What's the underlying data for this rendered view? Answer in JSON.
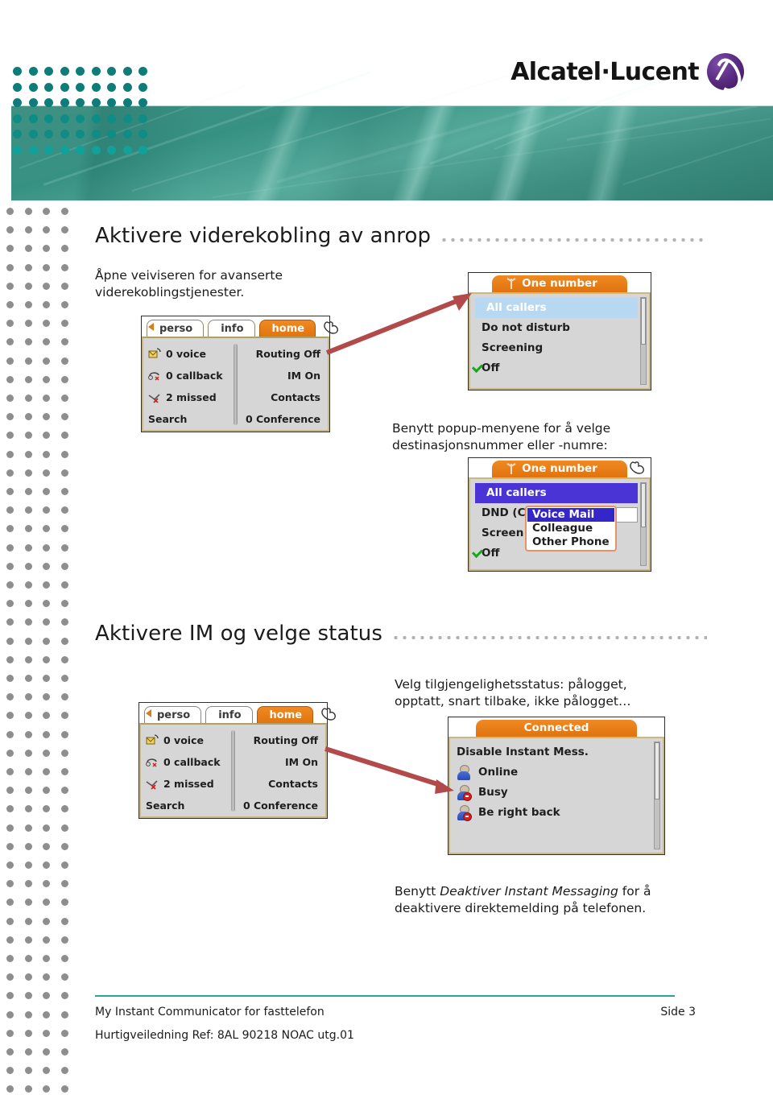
{
  "brand": {
    "name": "Alcatel·Lucent",
    "mark_icon": "alcatel-lucent-logo-icon",
    "accent_teal": "#3f9082",
    "accent_purple": "#5d2e85"
  },
  "sections": [
    {
      "id": "call-forwarding",
      "title": "Aktivere viderekobling av anrop",
      "intro": "Åpne veiviseren for avanserte viderekoblingstjenester.",
      "mid_text": "Benytt popup-menyene for å velge destinasjonsnummer eller -numre:"
    },
    {
      "id": "activate-im",
      "title": "Aktivere IM og velge status",
      "intro": "Velg tilgjengelighetsstatus: pålogget, opptatt, snart tilbake, ikke pålogget…",
      "outro_before": "Benytt ",
      "outro_em": "Deaktiver Instant Messaging",
      "outro_after": " for å deaktivere direktemelding på telefonen."
    }
  ],
  "phone_screen": {
    "tabs": [
      {
        "label": "perso",
        "active": false
      },
      {
        "label": "info",
        "active": false
      },
      {
        "label": "home",
        "active": true
      }
    ],
    "hand_icon": "hand-pointer-icon",
    "left_items": [
      {
        "label": "0 voice",
        "icon": "voicemail-icon"
      },
      {
        "label": "0 callback",
        "icon": "callback-icon"
      },
      {
        "label": "2 missed",
        "icon": "missed-call-icon"
      },
      {
        "label": "Search",
        "icon": ""
      }
    ],
    "right_items": [
      {
        "label": "Routing Off"
      },
      {
        "label": "IM On"
      },
      {
        "label": "Contacts"
      },
      {
        "label": "0 Conference"
      }
    ]
  },
  "panel_one_number": {
    "tab_label": "One number",
    "tab_icon": "call-forward-icon",
    "items": [
      {
        "label": "All callers",
        "state": "selected-light"
      },
      {
        "label": "Do not disturb",
        "state": "normal"
      },
      {
        "label": "Screening",
        "state": "normal"
      },
      {
        "label": "Off",
        "state": "checked"
      }
    ]
  },
  "panel_one_number_dropdown": {
    "tab_label": "One number",
    "tab_icon": "call-forward-icon",
    "hand_icon": "hand-pointer-icon",
    "items": [
      {
        "label": "All callers",
        "state": "selected-blue"
      },
      {
        "label": "DND (C",
        "state": "normal"
      },
      {
        "label": "Screen",
        "state": "normal"
      },
      {
        "label": "Off",
        "state": "checked"
      }
    ],
    "dropdown": {
      "options": [
        {
          "label": "Voice Mail",
          "selected": true
        },
        {
          "label": "Colleague",
          "selected": false
        },
        {
          "label": "Other Phone",
          "selected": false
        }
      ]
    }
  },
  "panel_connected": {
    "tab_label": "Connected",
    "items": [
      {
        "label": "Disable Instant Mess.",
        "icon": ""
      },
      {
        "label": "Online",
        "icon": "status-online-icon"
      },
      {
        "label": "Busy",
        "icon": "status-busy-icon"
      },
      {
        "label": "Be right back",
        "icon": "status-away-icon"
      }
    ]
  },
  "annotations": {
    "arrow_color": "#b24a4a",
    "arrow_one": "arrow-to-one-number-panel",
    "arrow_two": "arrow-to-connected-panel"
  },
  "footer": {
    "line1": "My Instant Communicator for fasttelefon",
    "line2": "Hurtigveiledning Ref: 8AL 90218 NOAC utg.01",
    "page": "Side 3"
  }
}
